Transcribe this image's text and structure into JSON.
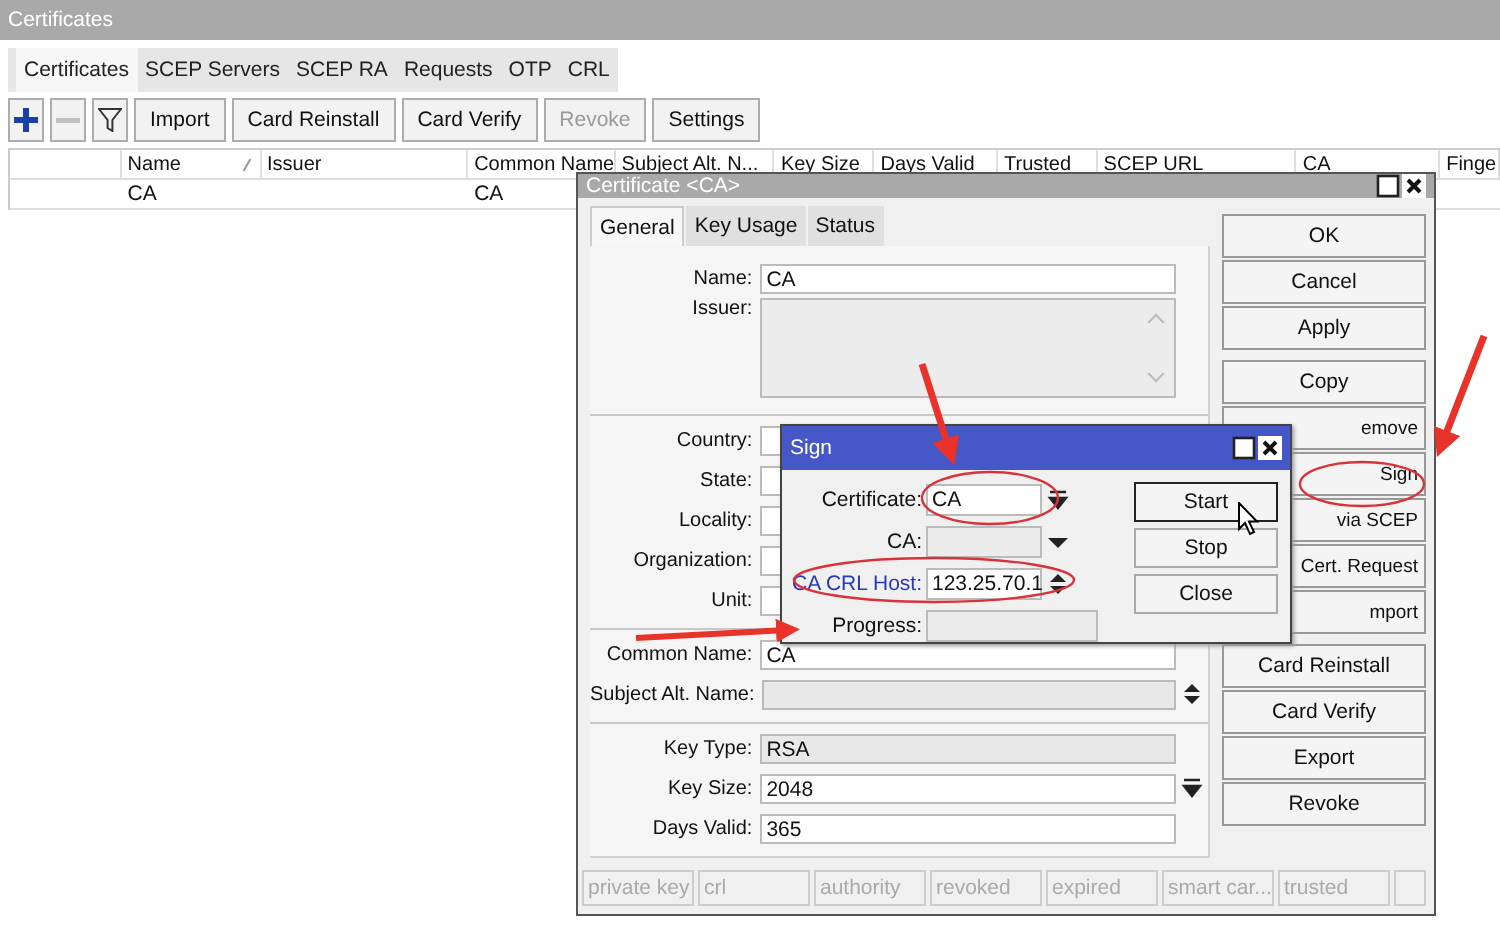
{
  "main_window": {
    "title": "Certificates",
    "tabs": [
      {
        "label": "Certificates",
        "selected": true
      },
      {
        "label": "SCEP Servers",
        "selected": false
      },
      {
        "label": "SCEP RA",
        "selected": false
      },
      {
        "label": "Requests",
        "selected": false
      },
      {
        "label": "OTP",
        "selected": false
      },
      {
        "label": "CRL",
        "selected": false
      }
    ],
    "toolbar": [
      {
        "kind": "add"
      },
      {
        "kind": "remove",
        "disabled": true
      },
      {
        "kind": "filter"
      },
      {
        "kind": "text",
        "label": "Import",
        "disabled": false
      },
      {
        "kind": "text",
        "label": "Card Reinstall",
        "disabled": false
      },
      {
        "kind": "text",
        "label": "Card Verify",
        "disabled": false
      },
      {
        "kind": "text",
        "label": "Revoke",
        "disabled": true
      },
      {
        "kind": "text",
        "label": "Settings",
        "disabled": false
      }
    ],
    "table": {
      "columns": [
        {
          "label": "Name",
          "kind": "name",
          "sorted": true
        },
        {
          "label": "Issuer",
          "kind": "issuer",
          "sorted": false
        },
        {
          "label": "Common Name",
          "kind": "common_name",
          "sorted": false
        },
        {
          "label": "Subject Alt. N...",
          "kind": "subject_alt",
          "sorted": false
        },
        {
          "label": "Key Size",
          "kind": "key_size",
          "sorted": false
        },
        {
          "label": "Days Valid",
          "kind": "days_valid",
          "sorted": false
        },
        {
          "label": "Trusted",
          "kind": "trusted",
          "sorted": false
        },
        {
          "label": "SCEP URL",
          "kind": "scep_url",
          "sorted": false
        },
        {
          "label": "CA",
          "kind": "ca",
          "sorted": false
        },
        {
          "label": "Finge",
          "kind": "fingerprint",
          "sorted": false
        }
      ],
      "rows": [
        {
          "name": "CA",
          "common_name": "CA"
        }
      ]
    }
  },
  "certificate_dialog": {
    "title": "Certificate <CA>",
    "tabs": [
      {
        "label": "General",
        "selected": true
      },
      {
        "label": "Key Usage",
        "selected": false
      },
      {
        "label": "Status",
        "selected": false
      }
    ],
    "sections": [
      [
        {
          "label": "Name:",
          "kind": "text",
          "value": "CA"
        },
        {
          "label": "Issuer:",
          "kind": "area"
        }
      ],
      [
        {
          "label": "Country:",
          "kind": "text"
        },
        {
          "label": "State:",
          "kind": "text"
        },
        {
          "label": "Locality:",
          "kind": "text"
        },
        {
          "label": "Organization:",
          "kind": "text"
        },
        {
          "label": "Unit:",
          "kind": "text"
        }
      ],
      [
        {
          "label": "Common Name:",
          "kind": "text",
          "value": "CA"
        },
        {
          "label": "Subject Alt. Name:",
          "kind": "updown",
          "disabled": true
        }
      ],
      [
        {
          "label": "Key Type:",
          "kind": "text",
          "value": "RSA",
          "disabled": true
        },
        {
          "label": "Key Size:",
          "kind": "dropdown",
          "value": "2048"
        },
        {
          "label": "Days Valid:",
          "kind": "text",
          "value": "365"
        }
      ]
    ],
    "button_groups": [
      [
        {
          "label": "OK",
          "covered": false
        },
        {
          "label": "Cancel",
          "covered": false
        },
        {
          "label": "Apply",
          "covered": false
        }
      ],
      [
        {
          "label": "Copy",
          "covered": false
        },
        {
          "label": "emove",
          "covered": true
        },
        {
          "label": "Sign",
          "covered": true
        },
        {
          "label": "via SCEP",
          "covered": true
        },
        {
          "label": "Cert. Request",
          "covered": true
        },
        {
          "label": "mport",
          "covered": true
        }
      ],
      [
        {
          "label": "Card Reinstall",
          "covered": false
        },
        {
          "label": "Card Verify",
          "covered": false
        },
        {
          "label": "Export",
          "covered": false
        },
        {
          "label": "Revoke",
          "covered": false
        }
      ]
    ],
    "status_bar": [
      "private key",
      "crl",
      "authority",
      "revoked",
      "expired",
      "smart car...",
      "trusted"
    ]
  },
  "sign_dialog": {
    "title": "Sign",
    "fields": [
      {
        "label": "Certificate:",
        "kind": "dropdown",
        "value": "CA",
        "link": false,
        "disabled": false
      },
      {
        "label": "CA:",
        "kind": "combo",
        "link": false,
        "disabled": true
      },
      {
        "label": "CA CRL Host:",
        "kind": "updown",
        "value": "123.25.70.1",
        "link": true,
        "disabled": false
      },
      {
        "label": "Progress:",
        "kind": "plain",
        "link": false,
        "disabled": true
      }
    ],
    "buttons": [
      {
        "label": "Start",
        "focused": true
      },
      {
        "label": "Stop",
        "focused": false
      },
      {
        "label": "Close",
        "focused": false
      }
    ]
  }
}
